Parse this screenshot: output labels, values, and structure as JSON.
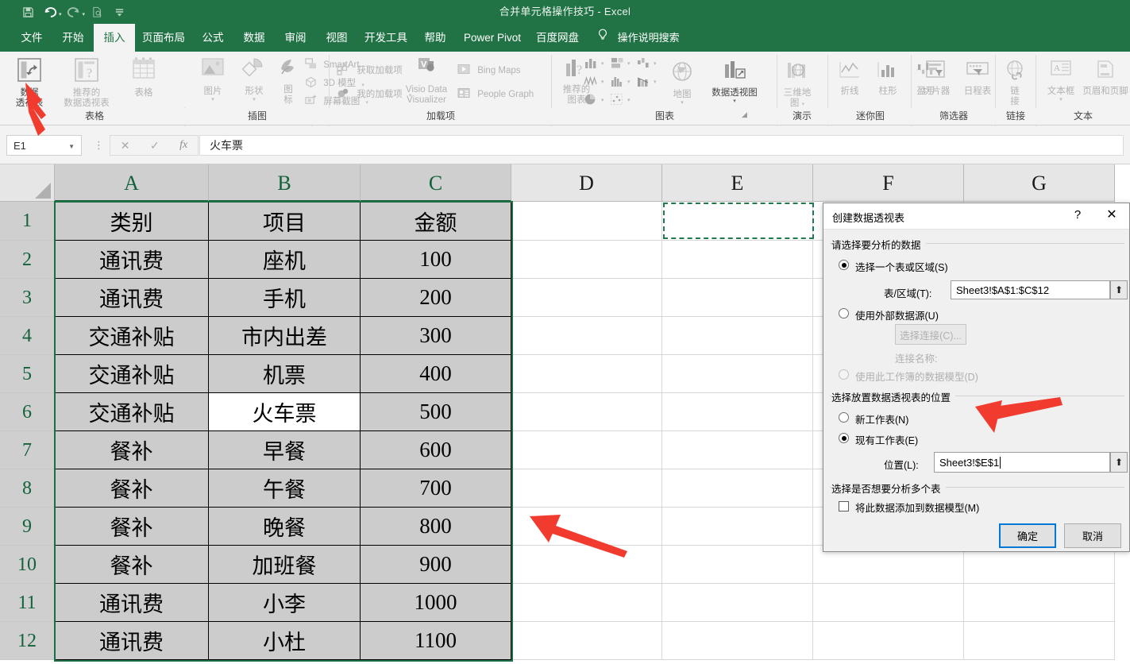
{
  "app": {
    "title": "合并单元格操作技巧  -  Excel",
    "accent_green": "#217346",
    "annotation_red": "#f23b2f"
  },
  "quick_access": [
    {
      "name": "save-icon",
      "glyph": "💾"
    },
    {
      "name": "undo-icon",
      "glyph": "↶"
    },
    {
      "name": "redo-icon",
      "glyph": "↷"
    },
    {
      "name": "print-preview-icon",
      "glyph": "⬚"
    },
    {
      "name": "customize-qat-icon",
      "glyph": "≡"
    }
  ],
  "tabs": [
    {
      "label": "文件",
      "active": false
    },
    {
      "label": "开始",
      "active": false
    },
    {
      "label": "插入",
      "active": true
    },
    {
      "label": "页面布局",
      "active": false
    },
    {
      "label": "公式",
      "active": false
    },
    {
      "label": "数据",
      "active": false
    },
    {
      "label": "审阅",
      "active": false
    },
    {
      "label": "视图",
      "active": false
    },
    {
      "label": "开发工具",
      "active": false
    },
    {
      "label": "帮助",
      "active": false
    },
    {
      "label": "Power Pivot",
      "active": false
    },
    {
      "label": "百度网盘",
      "active": false
    }
  ],
  "tell_me": {
    "icon": "lightbulb-icon",
    "label": "操作说明搜索"
  },
  "ribbon": {
    "groups": [
      {
        "label": "表格"
      },
      {
        "label": "插图"
      },
      {
        "label": "加载项"
      },
      {
        "label": "图表"
      },
      {
        "label": "演示"
      },
      {
        "label": "迷你图"
      },
      {
        "label": "筛选器"
      },
      {
        "label": "链接"
      },
      {
        "label": "文本"
      }
    ],
    "items": {
      "pivot_table": "数据\n透视表",
      "pivot_table_l1": "数据",
      "pivot_table_l2": "透视表",
      "recommended_pivot_l1": "推荐的",
      "recommended_pivot_l2": "数据透视表",
      "table": "表格",
      "pictures": "图片",
      "shapes": "形状",
      "icons_l1": "图",
      "icons_l2": "标",
      "smartart": "SmartArt",
      "model3d": "3D 模型",
      "screenshot": "屏幕截图",
      "get_addins": "获取加载项",
      "my_addins": "我的加载项",
      "visio_l1": "Visio Data",
      "visio_l2": "Visualizer",
      "bing_maps": "Bing Maps",
      "people_graph": "People Graph",
      "recommended_charts_l1": "推荐的",
      "recommended_charts_l2": "图表",
      "map_l1": "地图",
      "pivot_chart": "数据透视图",
      "map3d_l1": "三维地",
      "map3d_l2": "图",
      "sparkline_line": "折线",
      "sparkline_column": "柱形",
      "sparkline_winloss": "盈亏",
      "slicer": "切片器",
      "timeline": "日程表",
      "link_l1": "链",
      "link_l2": "接",
      "textbox": "文本框",
      "header_footer": "页眉和页脚"
    }
  },
  "formula_bar": {
    "name_box": "E1",
    "cancel_icon": "✕",
    "confirm_icon": "✓",
    "fx_icon": "fx",
    "value": "火车票"
  },
  "grid": {
    "columns": [
      "A",
      "B",
      "C",
      "D",
      "E",
      "F",
      "G"
    ],
    "rows": [
      "1",
      "2",
      "3",
      "4",
      "5",
      "6",
      "7",
      "8",
      "9",
      "10",
      "11",
      "12"
    ],
    "headers": [
      "类别",
      "项目",
      "金额"
    ],
    "data": [
      [
        "类别",
        "项目",
        "金额"
      ],
      [
        "通讯费",
        "座机",
        "100"
      ],
      [
        "通讯费",
        "手机",
        "200"
      ],
      [
        "交通补贴",
        "市内出差",
        "300"
      ],
      [
        "交通补贴",
        "机票",
        "400"
      ],
      [
        "交通补贴",
        "火车票",
        "500"
      ],
      [
        "餐补",
        "早餐",
        "600"
      ],
      [
        "餐补",
        "午餐",
        "700"
      ],
      [
        "餐补",
        "晚餐",
        "800"
      ],
      [
        "餐补",
        "加班餐",
        "900"
      ],
      [
        "通讯费",
        "小李",
        "1000"
      ],
      [
        "通讯费",
        "小杜",
        "1100"
      ]
    ],
    "active_cell": "B6",
    "selected_range": "A1:C12",
    "marching_ants_cell": "E1"
  },
  "dialog": {
    "title": "创建数据透视表",
    "help_glyph": "?",
    "close_glyph": "✕",
    "section1": "请选择要分析的数据",
    "radio_range": "选择一个表或区域(S)",
    "range_label": "表/区域(T):",
    "range_value": "Sheet3!$A$1:$C$12",
    "radio_external": "使用外部数据源(U)",
    "choose_connection": "选择连接(C)...",
    "connection_name_label": "连接名称:",
    "radio_data_model": "使用此工作簿的数据模型(D)",
    "section2": "选择放置数据透视表的位置",
    "radio_new_sheet": "新工作表(N)",
    "radio_existing_sheet": "现有工作表(E)",
    "location_label": "位置(L):",
    "location_value": "Sheet3!$E$1",
    "section3": "选择是否想要分析多个表",
    "checkbox_add_to_model": "将此数据添加到数据模型(M)",
    "ok": "确定",
    "cancel": "取消",
    "picker_glyph": "⬆"
  },
  "annotations": [
    {
      "name": "arrow-to-pivot-table-button"
    },
    {
      "name": "arrow-to-location-field"
    },
    {
      "name": "arrow-to-grid-area"
    }
  ]
}
